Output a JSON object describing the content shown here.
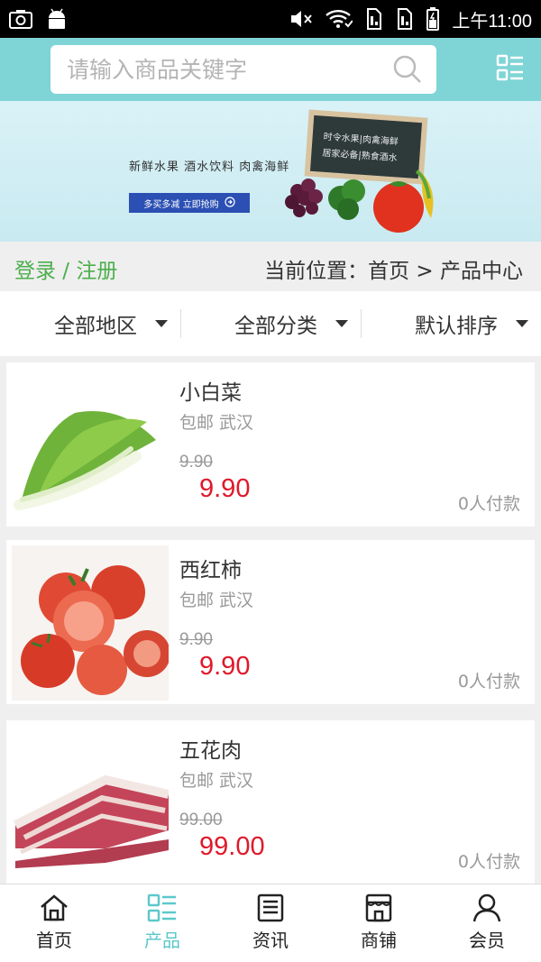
{
  "status_bar": {
    "time": "上午11:00",
    "icons": [
      "camera-icon",
      "android-icon",
      "mute-icon",
      "wifi-icon",
      "sim1-icon",
      "sim2-icon",
      "battery-icon"
    ]
  },
  "header": {
    "search_placeholder": "请输入商品关键字",
    "search_value": "",
    "menu_icon": "list-menu-icon"
  },
  "banner": {
    "tagline": "新鲜水果  酒水饮料  肉禽海鲜",
    "button": "多买多减 立即抢购",
    "board_line1": "时令水果|肉禽海鲜",
    "board_line2": "居家必备|熟食酒水"
  },
  "info_bar": {
    "login": "登录 / 注册",
    "location": "当前位置：首页 > 产品中心"
  },
  "filters": [
    {
      "label": "全部地区"
    },
    {
      "label": "全部分类"
    },
    {
      "label": "默认排序"
    }
  ],
  "products": [
    {
      "name": "小白菜",
      "meta": "包邮 武汉",
      "original_price": "9.90",
      "price": "9.90",
      "sales": "0人付款"
    },
    {
      "name": "西红柿",
      "meta": "包邮 武汉",
      "original_price": "9.90",
      "price": "9.90",
      "sales": "0人付款"
    },
    {
      "name": "五花肉",
      "meta": "包邮 武汉",
      "original_price": "99.00",
      "price": "99.00",
      "sales": "0人付款"
    }
  ],
  "bottom_nav": [
    {
      "label": "首页",
      "icon": "home-icon",
      "active": false
    },
    {
      "label": "产品",
      "icon": "grid-list-icon",
      "active": true
    },
    {
      "label": "资讯",
      "icon": "news-icon",
      "active": false
    },
    {
      "label": "商铺",
      "icon": "shop-icon",
      "active": false
    },
    {
      "label": "会员",
      "icon": "user-icon",
      "active": false
    }
  ],
  "colors": {
    "header_bg": "#7fd4d6",
    "accent": "#5cc8cc",
    "price_red": "#e0182a",
    "login_green": "#4cae4c",
    "banner_button": "#2b4fb3"
  }
}
